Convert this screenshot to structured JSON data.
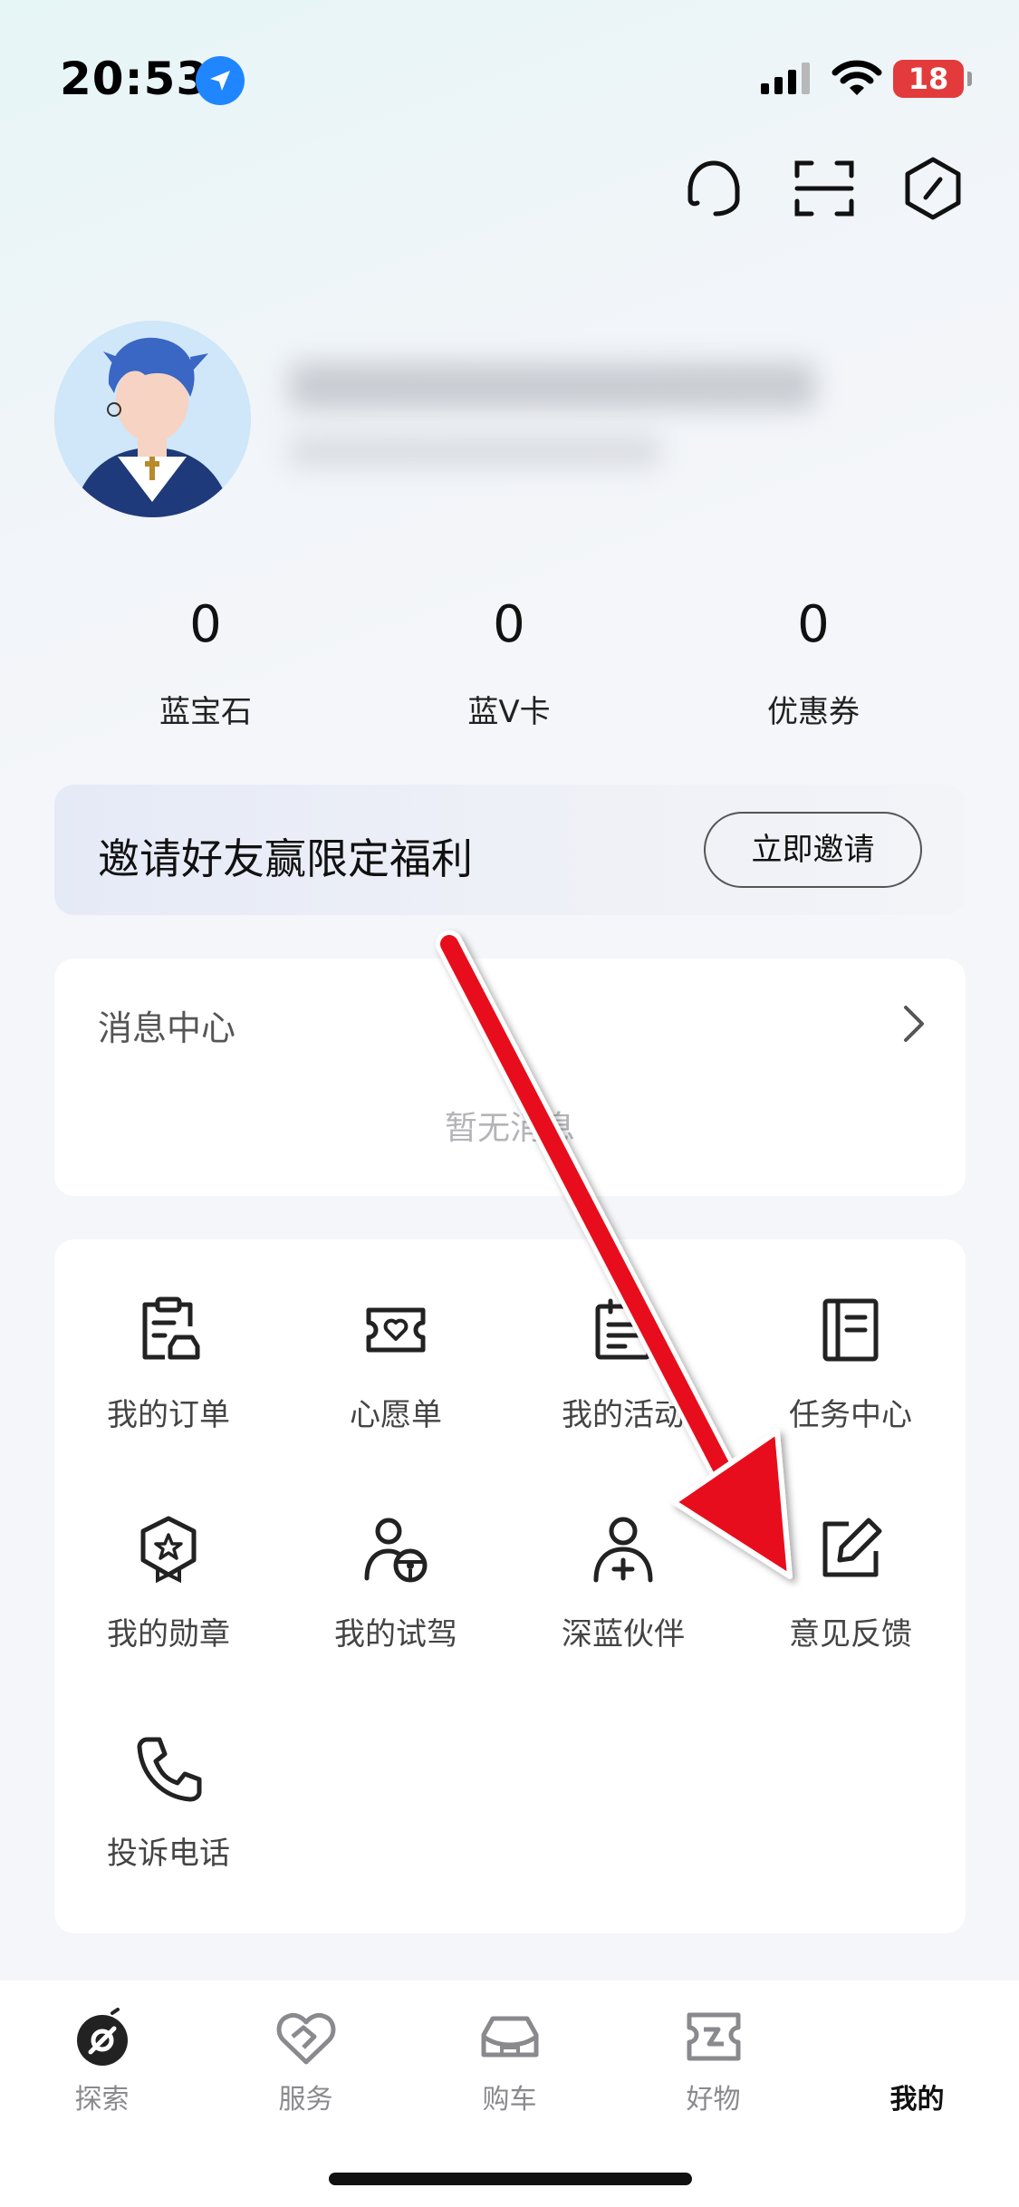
{
  "status_bar": {
    "time": "20:53",
    "battery": "18"
  },
  "profile": {
    "stats": [
      {
        "value": "0",
        "label": "蓝宝石"
      },
      {
        "value": "0",
        "label": "蓝V卡"
      },
      {
        "value": "0",
        "label": "优惠券"
      }
    ]
  },
  "invite": {
    "text": "邀请好友赢限定福利",
    "button": "立即邀请"
  },
  "messages": {
    "title": "消息中心",
    "empty": "暂无消息"
  },
  "services": [
    {
      "label": "我的订单",
      "icon": "order-icon"
    },
    {
      "label": "心愿单",
      "icon": "wishlist-icon"
    },
    {
      "label": "我的活动",
      "icon": "activity-icon"
    },
    {
      "label": "任务中心",
      "icon": "task-icon"
    },
    {
      "label": "我的勋章",
      "icon": "medal-icon"
    },
    {
      "label": "我的试驾",
      "icon": "test-drive-icon"
    },
    {
      "label": "深蓝伙伴",
      "icon": "partner-icon"
    },
    {
      "label": "意见反馈",
      "icon": "feedback-icon"
    },
    {
      "label": "投诉电话",
      "icon": "phone-icon"
    }
  ],
  "tabbar": [
    {
      "label": "探索",
      "icon": "explore-icon",
      "active": false
    },
    {
      "label": "服务",
      "icon": "service-icon",
      "active": false
    },
    {
      "label": "购车",
      "icon": "car-icon",
      "active": false
    },
    {
      "label": "好物",
      "icon": "goods-icon",
      "active": false
    },
    {
      "label": "我的",
      "icon": "",
      "active": true
    }
  ],
  "colors": {
    "accent_arrow": "#e8101a",
    "battery": "#e33b3b",
    "location": "#1f86ff"
  }
}
